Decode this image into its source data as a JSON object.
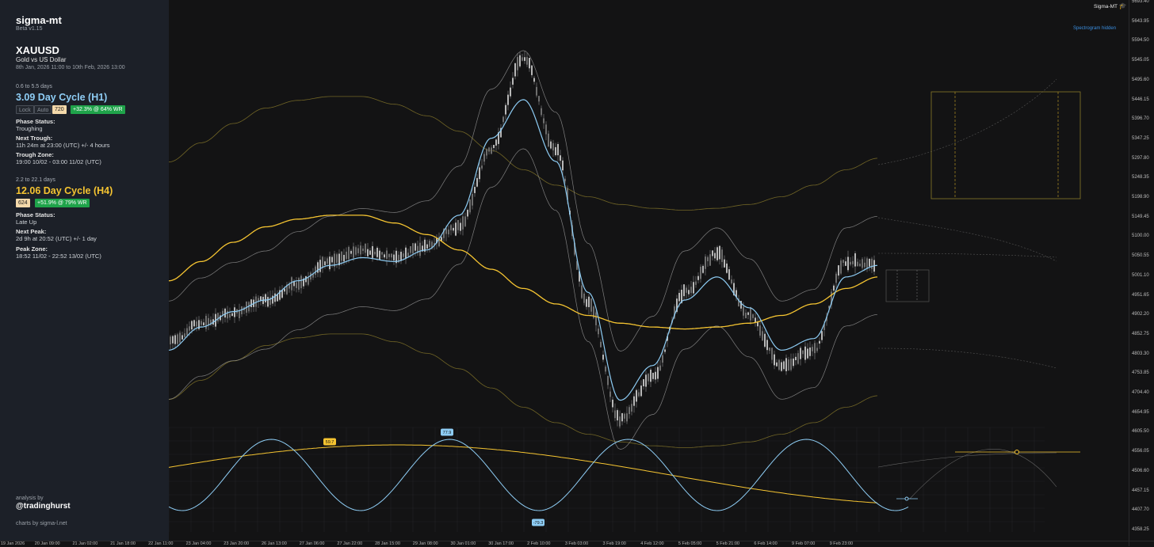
{
  "app": {
    "title": "sigma-mt",
    "version": "Beta v1.15",
    "badge": "Sigma-MT",
    "badge_icon": "graduation-cap-icon",
    "spectrogram": "Spectrogram hidden"
  },
  "instrument": {
    "symbol": "XAUUSD",
    "description": "Gold vs US Dollar",
    "range": "8th Jan, 2026 11:00 to 10th Feb, 2026 13:00"
  },
  "cycles": [
    {
      "range_label": "0.6 to 5.5 days",
      "title": "3.09 Day Cycle (H1)",
      "color": "#8ecdf5",
      "buttons": [
        "Lock",
        "Auto"
      ],
      "length": "720",
      "performance": "+32.3% @ 64% WR",
      "phase_status_label": "Phase Status:",
      "phase_status": "Troughing",
      "next_label": "Next Trough:",
      "next_value": "11h 24m at 23:00 (UTC) +/- 4 hours",
      "zone_label": "Trough Zone:",
      "zone_value": "19:00 10/02 - 03:00 11/02 (UTC)"
    },
    {
      "range_label": "2.2 to 22.1 days",
      "title": "12.06 Day Cycle (H4)",
      "color": "#f5c431",
      "length": "624",
      "performance": "+51.9% @ 79% WR",
      "phase_status_label": "Phase Status:",
      "phase_status": "Late Up",
      "next_label": "Next Peak:",
      "next_value": "2d 9h at 20:52 (UTC) +/- 1 day",
      "zone_label": "Peak Zone:",
      "zone_value": "18:52 11/02 - 22:52 13/02 (UTC)"
    }
  ],
  "footer": {
    "analysis_by": "analysis by",
    "handle": "@tradinghurst",
    "credit": "charts by sigma-l.net"
  },
  "y_axis": [
    "5693.40",
    "5643.95",
    "5594.50",
    "5545.05",
    "5495.60",
    "5446.15",
    "5396.70",
    "5347.25",
    "5297.80",
    "5248.35",
    "5198.90",
    "5149.45",
    "5100.00",
    "5050.55",
    "5001.10",
    "4951.65",
    "4902.20",
    "4852.75",
    "4803.30",
    "4753.85",
    "4704.40",
    "4654.95",
    "4605.50",
    "4556.05",
    "4506.60",
    "4457.15",
    "4407.70",
    "4358.25"
  ],
  "x_axis": [
    "19 Jan 2026",
    "20 Jan 09:00",
    "21 Jan 02:00",
    "21 Jan 18:00",
    "22 Jan 11:00",
    "23 Jan 04:00",
    "23 Jan 20:00",
    "26 Jan 13:00",
    "27 Jan 06:00",
    "27 Jan 22:00",
    "28 Jan 15:00",
    "29 Jan 08:00",
    "30 Jan 01:00",
    "30 Jan 17:00",
    "2 Feb 10:00",
    "3 Feb 03:00",
    "3 Feb 19:00",
    "4 Feb 12:00",
    "5 Feb 05:00",
    "5 Feb 21:00",
    "6 Feb 14:00",
    "9 Feb 07:00",
    "9 Feb 23:00"
  ],
  "oscillator_labels": {
    "h4_peak": "59.7",
    "h1_peak": "77.9",
    "h1_trough": "-79.3"
  },
  "colors": {
    "h1": "#8ecdf5",
    "h4": "#f5c431",
    "sidebar": "#1c2028",
    "background": "#131314",
    "positive": "#1fa34a"
  },
  "chart_data": {
    "type": "line",
    "y_range": [
      4358.25,
      5693.4
    ],
    "x": [
      "19 Jan 2026",
      "20 Jan 09:00",
      "21 Jan 02:00",
      "21 Jan 18:00",
      "22 Jan 11:00",
      "23 Jan 04:00",
      "23 Jan 20:00",
      "26 Jan 13:00",
      "27 Jan 06:00",
      "27 Jan 22:00",
      "28 Jan 15:00",
      "29 Jan 08:00",
      "30 Jan 01:00",
      "30 Jan 17:00",
      "2 Feb 10:00",
      "3 Feb 03:00",
      "3 Feb 19:00",
      "4 Feb 12:00",
      "5 Feb 05:00",
      "5 Feb 21:00",
      "6 Feb 14:00",
      "9 Feb 07:00",
      "9 Feb 23:00"
    ],
    "series": [
      {
        "values": [
          4850,
          4900,
          4925,
          4960,
          5000,
          5060,
          5090,
          5070,
          5100,
          5150,
          5350,
          5590,
          5350,
          4950,
          4650,
          4760,
          4980,
          5080,
          4920,
          4790,
          4830,
          5060,
          5050
        ]
      },
      {
        "values": [
          4830,
          4890,
          4930,
          4960,
          5010,
          5050,
          5070,
          5060,
          5090,
          5180,
          5380,
          5480,
          5320,
          4980,
          4700,
          4790,
          4960,
          5020,
          4940,
          4830,
          4860,
          5020,
          5050
        ]
      },
      {
        "values": [
          5010,
          5060,
          5110,
          5150,
          5170,
          5180,
          5180,
          5160,
          5130,
          5090,
          5040,
          4990,
          4950,
          4920,
          4900,
          4890,
          4885,
          4890,
          4900,
          4920,
          4950,
          4990,
          5020
        ]
      }
    ]
  }
}
